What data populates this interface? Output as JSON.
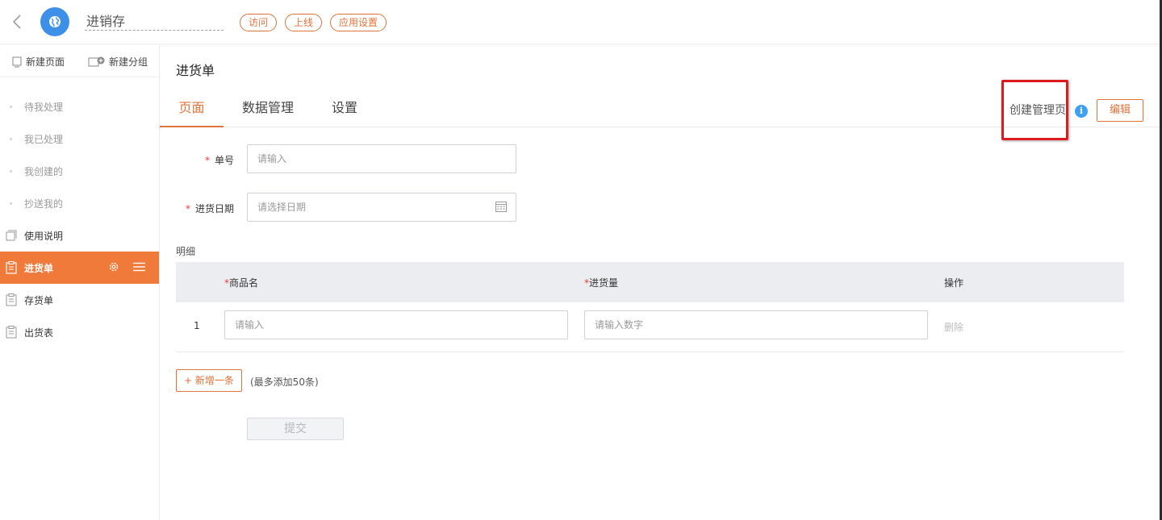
{
  "header": {
    "app_name": "进销存",
    "visit_label": "访问",
    "online_label": "上线",
    "app_settings_label": "应用设置"
  },
  "sidebar": {
    "new_page_label": "新建页面",
    "new_group_label": "新建分组",
    "sub_items": [
      "待我处理",
      "我已处理",
      "我创建的",
      "抄送我的"
    ],
    "items": [
      "使用说明",
      "进货单",
      "存货单",
      "出货表"
    ],
    "active_item": "进货单"
  },
  "main": {
    "page_title": "进货单",
    "tabs": [
      "页面",
      "数据管理",
      "设置"
    ],
    "active_tab": "页面",
    "create_manage_label": "创建管理页",
    "info_glyph": "i",
    "edit_label": "编辑"
  },
  "form": {
    "order_no_label": "单号",
    "order_no_placeholder": "请输入",
    "date_label": "进货日期",
    "date_placeholder": "请选择日期",
    "required_mark": "*",
    "detail_label": "明细",
    "columns": [
      "商品名",
      "进货量",
      "操作"
    ],
    "rows": [
      {
        "index": "1",
        "name_placeholder": "请输入",
        "qty_placeholder": "请输入数字",
        "delete_label": "删除"
      }
    ],
    "add_row_label": "新增一条",
    "add_row_hint": "(最多添加50条)",
    "submit_label": "提交"
  },
  "colors": {
    "accent": "#e0733a",
    "active_nav_bg": "#f07a3a",
    "app_logo": "#3d8fe8",
    "required": "#e23d3d",
    "info": "#3d9ff5",
    "highlight_box": "#e0191f"
  },
  "icons": [
    "chevron-left-icon",
    "globe-icon",
    "new-page-icon",
    "new-folder-icon",
    "doc-copy-icon",
    "clipboard-icon",
    "gear-icon",
    "menu-icon",
    "calendar-icon",
    "info-icon",
    "plus-icon"
  ]
}
